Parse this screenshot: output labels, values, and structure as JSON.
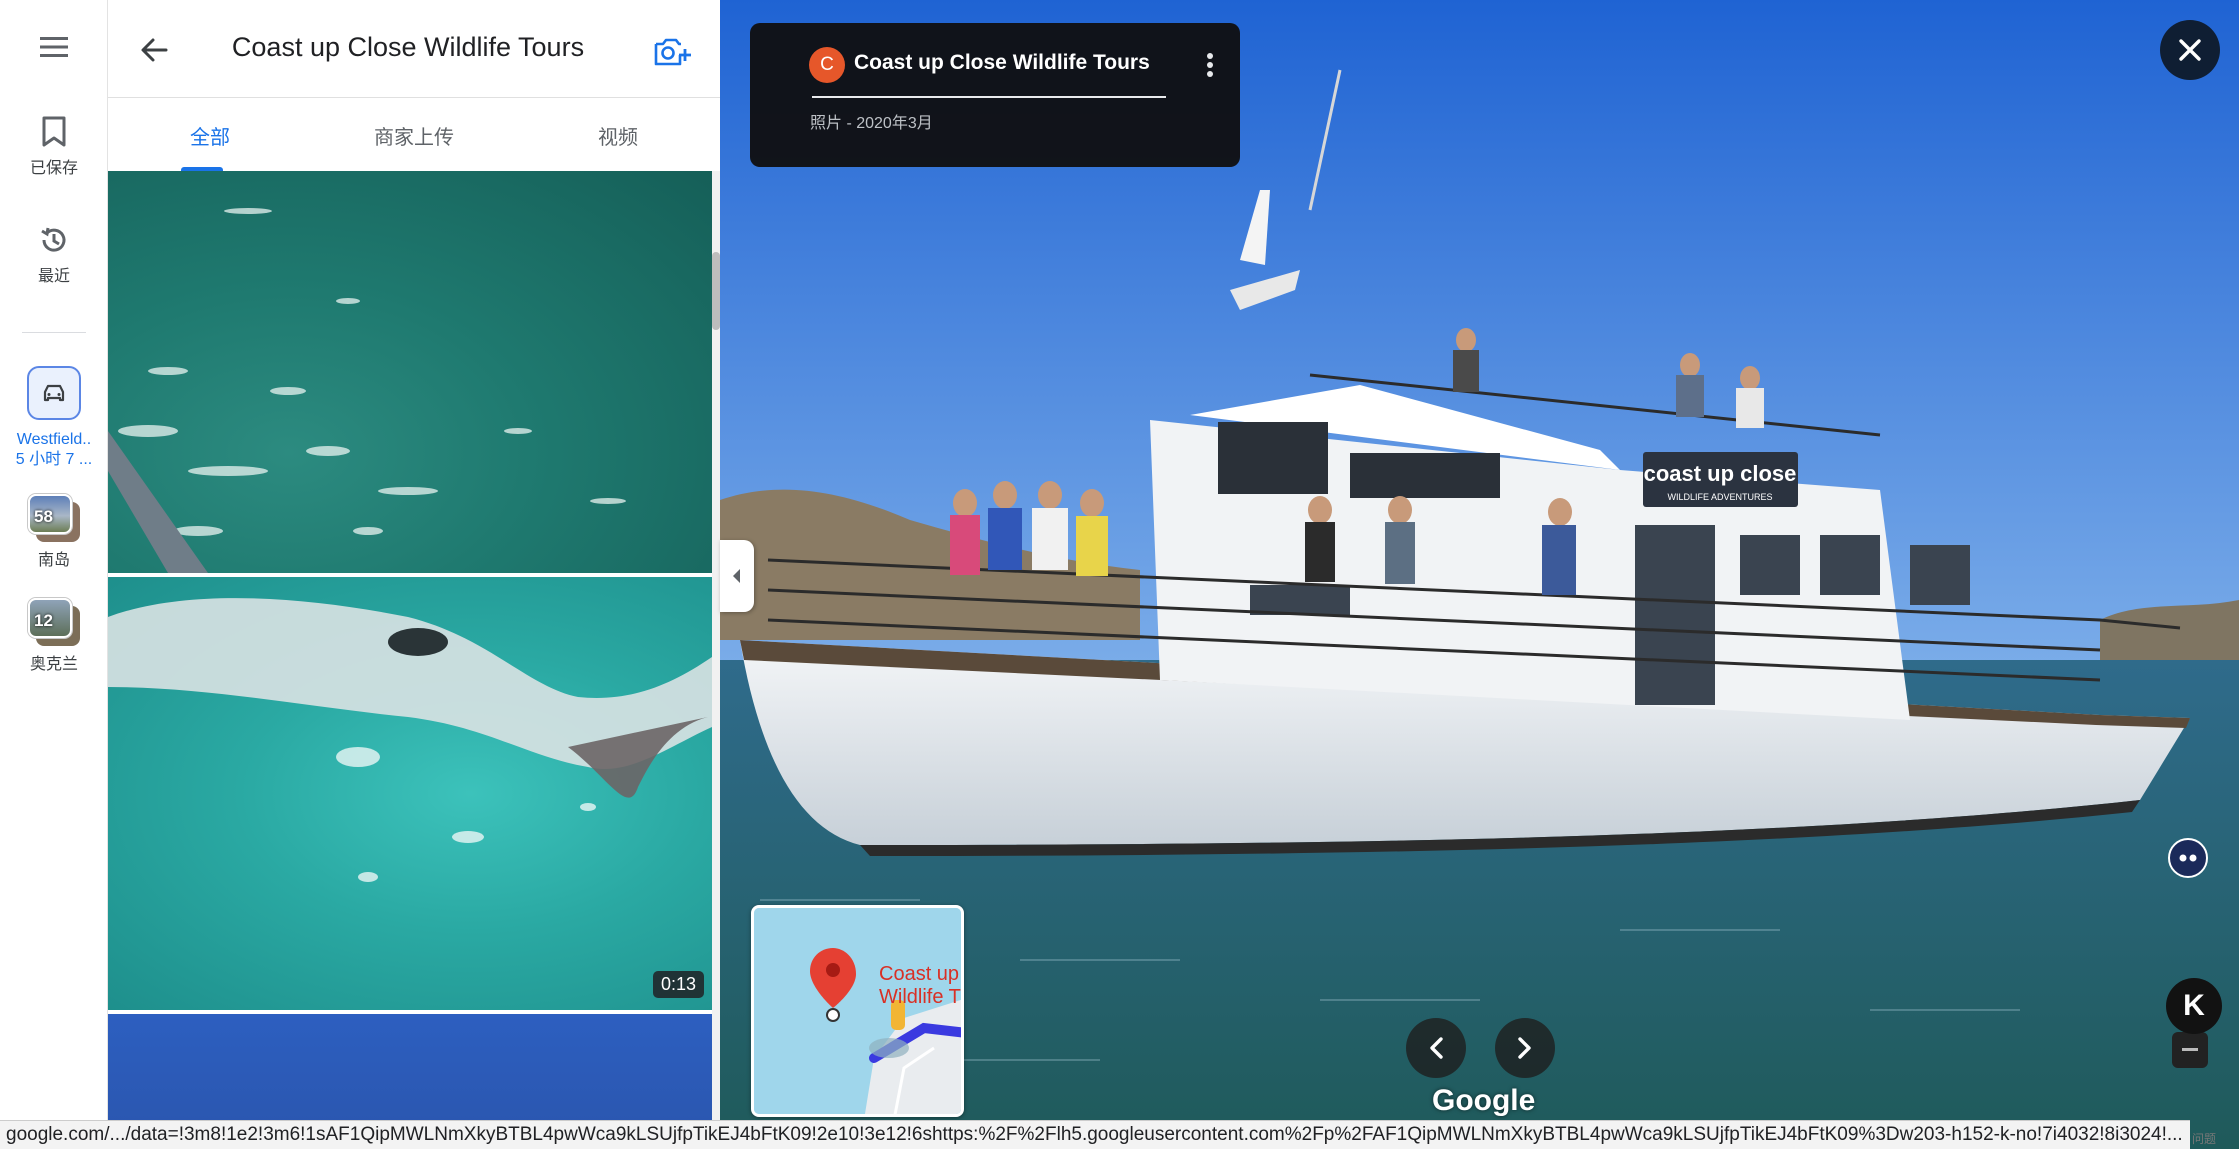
{
  "rail": {
    "menu_icon": "menu-icon",
    "saved_label": "已保存",
    "recent_label": "最近",
    "recent_trip": {
      "line1": "Westfield..",
      "line2": "5 小时 7 ..."
    },
    "collections": [
      {
        "count": "58",
        "label": "南岛"
      },
      {
        "count": "12",
        "label": "奥克兰"
      }
    ]
  },
  "panel": {
    "title": "Coast up Close Wildlife Tours",
    "tabs": [
      {
        "label": "全部"
      },
      {
        "label": "商家上传"
      },
      {
        "label": "视频"
      }
    ],
    "video_duration": "0:13"
  },
  "viewer": {
    "avatar_letter": "C",
    "title": "Coast up Close Wildlife Tours",
    "subtitle": "照片 - 2020年3月",
    "boat_sign_line1": "coast up close",
    "boat_sign_line2": "WILDLIFE ADVENTURES",
    "minimap_label_line1": "Coast up",
    "minimap_label_line2": "Wildlife T",
    "brand": "Google",
    "k_label": "K"
  },
  "status_url": "google.com/.../data=!3m8!1e2!3m6!1sAF1QipMWLNmXkyBTBL4pwWca9kLSUjfpTikEJ4bFtK09!2e10!3e12!6shttps:%2F%2Flh5.googleusercontent.com%2Fp%2FAF1QipMWLNmXkyBTBL4pwWca9kLSUjfpTikEJ4bFtK09%3Dw203-h152-k-no!7i4032!8i3024!...",
  "corner_text": "问题",
  "colors": {
    "accent": "#1a73e8",
    "avatar": "#e6572a",
    "card": "#101012"
  }
}
